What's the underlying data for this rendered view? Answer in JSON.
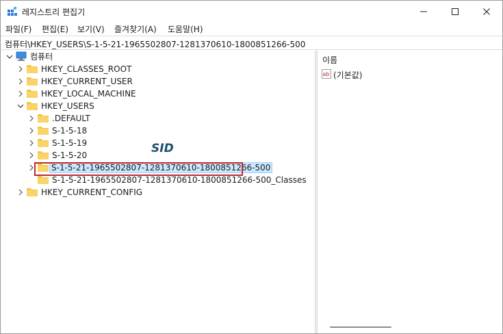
{
  "window": {
    "title": "레지스트리 편집기",
    "icons": {
      "app": "registry-editor-icon",
      "minimize": "minimize-icon",
      "maximize": "maximize-icon",
      "close": "close-icon"
    }
  },
  "menu": [
    "파일(F)",
    "편집(E)",
    "보기(V)",
    "즐겨찾기(A)",
    "도움말(H)"
  ],
  "address": "컴퓨터\\HKEY_USERS\\S-1-5-21-1965502807-1281370610-1800851266-500",
  "tree": {
    "root": "컴퓨터",
    "nodes": [
      {
        "label": "HKEY_CLASSES_ROOT"
      },
      {
        "label": "HKEY_CURRENT_USER"
      },
      {
        "label": "HKEY_LOCAL_MACHINE"
      },
      {
        "label": "HKEY_USERS"
      },
      {
        "label": ".DEFAULT"
      },
      {
        "label": "S-1-5-18"
      },
      {
        "label": "S-1-5-19"
      },
      {
        "label": "S-1-5-20"
      },
      {
        "label": "S-1-5-21-1965502807-1281370610-1800851266-500",
        "selected": true
      },
      {
        "label": "S-1-5-21-1965502807-1281370610-1800851266-500_Classes"
      },
      {
        "label": "HKEY_CURRENT_CONFIG"
      }
    ],
    "annotation": "SID"
  },
  "list": {
    "column_name": "이름",
    "values": [
      {
        "name": "(기본값)",
        "icon": "string-value-icon"
      }
    ]
  },
  "colors": {
    "selection": "#cce8ff",
    "selection_border": "#99d1ff",
    "annotation_box": "#c0282d",
    "annotation_text": "#1e4f6e",
    "folder": "#f4c542"
  }
}
